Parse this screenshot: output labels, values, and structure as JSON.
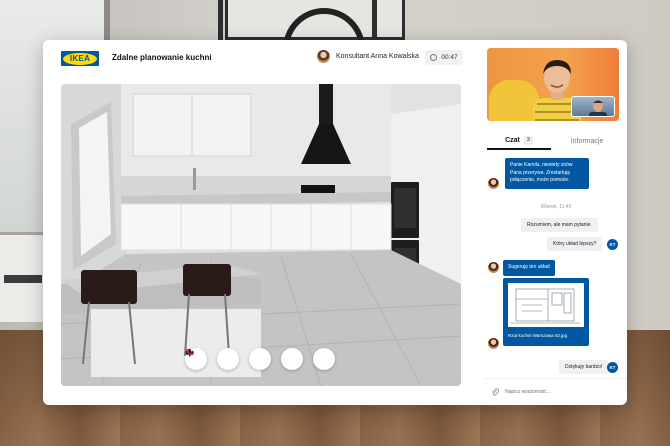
{
  "header": {
    "logo_text": "IKEA",
    "title": "Zdalne planowanie kuchni",
    "consultant": "Konsultant Anna Kowalska",
    "timer": "00:47"
  },
  "controls": [
    {
      "icon": "cursor-icon"
    },
    {
      "icon": "speaker-icon"
    },
    {
      "icon": "microphone-icon"
    },
    {
      "icon": "camera-icon"
    },
    {
      "icon": "phone-icon"
    }
  ],
  "tabs": {
    "chat_label": "Czat",
    "chat_badge": "3",
    "info_label": "Informacje"
  },
  "chat": {
    "msg1_line1": "Panie Kamilu, niestety znów",
    "msg1_line2": "Pana przerywa. Zrestartuję",
    "msg1_line3": "połączenie, może pomoże.",
    "time_separator": "Wtorek, 11:45",
    "msg2": "Rozumiem, ale mam pytanie.",
    "msg3": "Który układ lepszy?",
    "msg4": "Sugeruję ten układ",
    "attachment_caption": "Rzut kuchni Warszawa 02.jpg",
    "msg5": "Dziękuję bardzo!",
    "user_initials": "KT"
  },
  "composer": {
    "placeholder": "Napisz wiadomość..."
  },
  "colors": {
    "brand_blue": "#0058a3",
    "brand_yellow": "#ffdb00",
    "call_red": "#d9363e"
  }
}
